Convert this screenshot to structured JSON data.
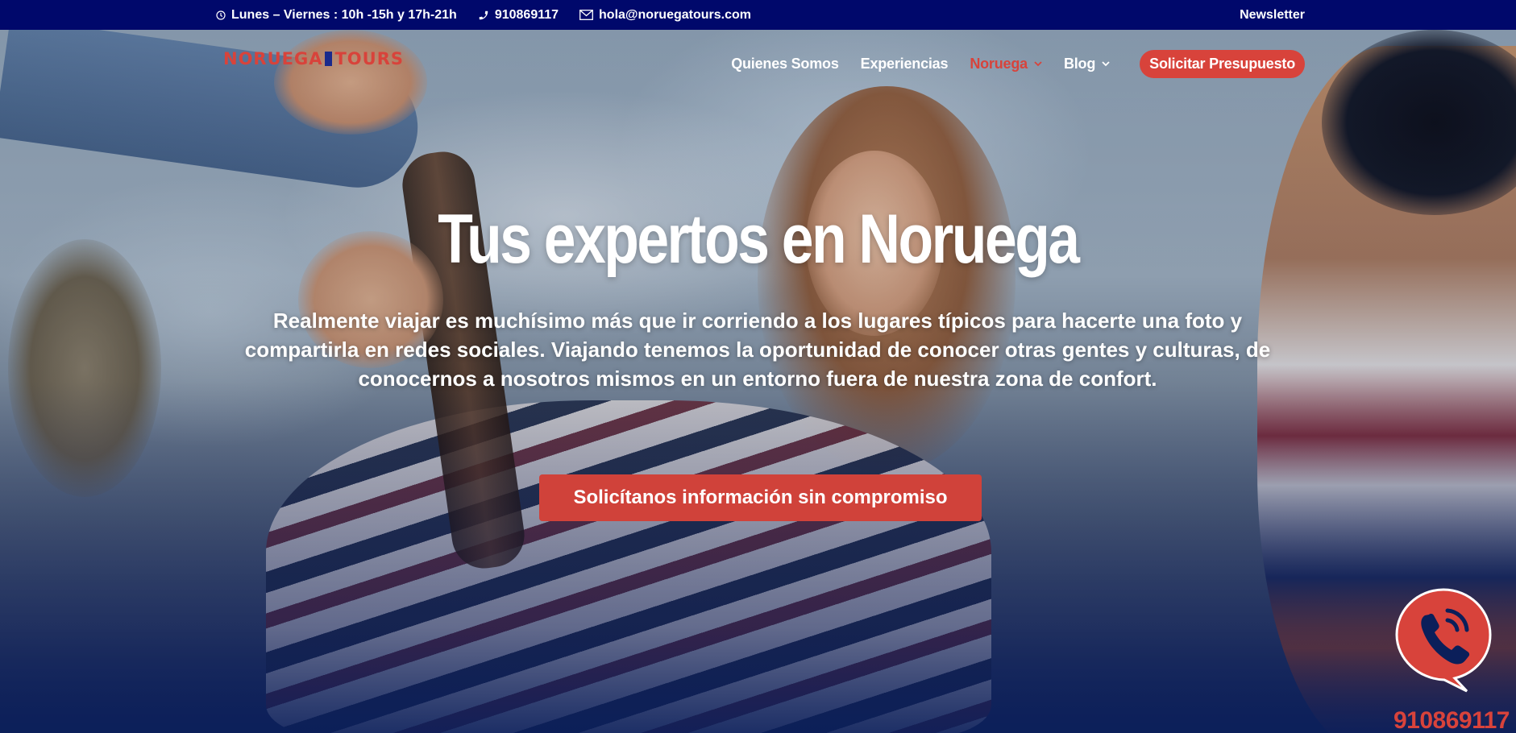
{
  "topbar": {
    "hours": "Lunes – Viernes : 10h -15h y 17h-21h",
    "phone": "910869117",
    "email": "hola@noruegatours.com",
    "newsletter": "Newsletter",
    "hours_icon": "clock-icon",
    "phone_icon": "phone-icon",
    "email_icon": "mail-icon"
  },
  "logo": {
    "part1": "NORUEGA",
    "part2": "TOURS"
  },
  "nav": {
    "items": [
      {
        "label": "Quienes Somos"
      },
      {
        "label": "Experiencias"
      },
      {
        "label": "Noruega"
      },
      {
        "label": "Blog"
      }
    ],
    "cta": "Solicitar Presupuesto"
  },
  "hero": {
    "title": "Tus expertos en Noruega",
    "text": "Realmente viajar es muchísimo más que ir corriendo a los lugares típicos para hacerte una foto y compartirla en redes sociales. Viajando tenemos la oportunidad de conocer otras gentes y culturas, de conocernos a nosotros mismos en un entorno fuera de nuestra zona de confort.",
    "button": "Solicítanos información sin compromiso"
  },
  "call_widget": {
    "icon": "phone-call-icon",
    "number": "910869117"
  },
  "colors": {
    "topbar": "#00086b",
    "accent": "#d8433b",
    "text": "#ffffff"
  }
}
